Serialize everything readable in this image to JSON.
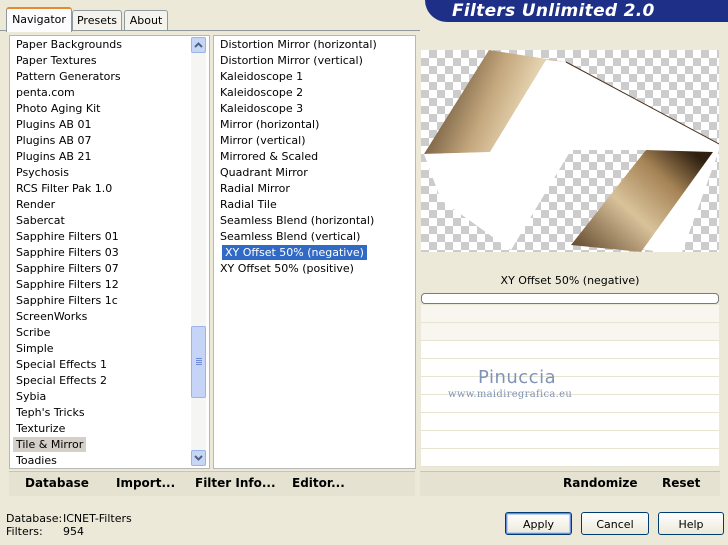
{
  "app_title": "Filters Unlimited 2.0",
  "tabs": [
    {
      "label": "Navigator",
      "active": true
    },
    {
      "label": "Presets",
      "active": false
    },
    {
      "label": "About",
      "active": false
    }
  ],
  "categories": {
    "items": [
      "Paper Backgrounds",
      "Paper Textures",
      "Pattern Generators",
      "penta.com",
      "Photo Aging Kit",
      "Plugins AB 01",
      "Plugins AB 07",
      "Plugins AB 21",
      "Psychosis",
      "RCS Filter Pak 1.0",
      "Render",
      "Sabercat",
      "Sapphire Filters 01",
      "Sapphire Filters 03",
      "Sapphire Filters 07",
      "Sapphire Filters 12",
      "Sapphire Filters 1c",
      "ScreenWorks",
      "Scribe",
      "Simple",
      "Special Effects 1",
      "Special Effects 2",
      "Sybia",
      "Teph's Tricks",
      "Texturize",
      "Tile & Mirror",
      "Toadies"
    ],
    "selected": "Tile & Mirror"
  },
  "filters": {
    "items": [
      "Distortion Mirror (horizontal)",
      "Distortion Mirror (vertical)",
      "Kaleidoscope 1",
      "Kaleidoscope 2",
      "Kaleidoscope 3",
      "Mirror (horizontal)",
      "Mirror (vertical)",
      "Mirrored & Scaled",
      "Quadrant Mirror",
      "Radial Mirror",
      "Radial Tile",
      "Seamless Blend (horizontal)",
      "Seamless Blend (vertical)",
      "XY Offset 50% (negative)",
      "XY Offset 50% (positive)"
    ],
    "selected": "XY Offset 50% (negative)"
  },
  "preview": {
    "filter_name": "XY Offset 50% (negative)",
    "progress": 0
  },
  "watermark": {
    "name": "Pinuccia",
    "url": "www.maidiregrafica.eu"
  },
  "toolbar": {
    "database": "Database",
    "import": "Import...",
    "filter_info": "Filter Info...",
    "editor": "Editor...",
    "randomize": "Randomize",
    "reset": "Reset"
  },
  "status": {
    "database_label": "Database:",
    "database_value": "ICNET-Filters",
    "filters_label": "Filters:",
    "filters_value": "954"
  },
  "buttons": {
    "apply": "Apply",
    "cancel": "Cancel",
    "help": "Help"
  },
  "colors": {
    "banner": "#1d2f86",
    "selection": "#316ac5",
    "accent_tab": "#e68b2c"
  }
}
